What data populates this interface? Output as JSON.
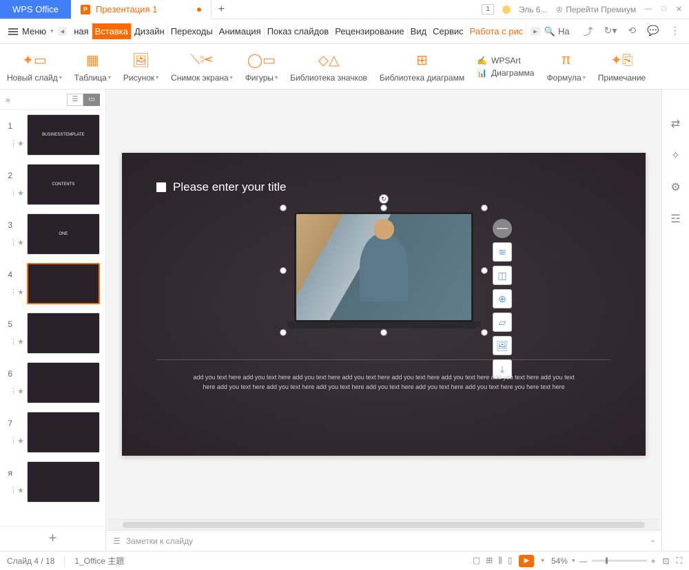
{
  "titlebar": {
    "app_name": "WPS Office",
    "tab_title": "Презентация 1",
    "tab_indicator": "1",
    "premium_label": "Перейти Премиум"
  },
  "menubar": {
    "menu_label": "Меню",
    "search_label": "На",
    "tabs": [
      "ная",
      "Вставка",
      "Дизайн",
      "Переходы",
      "Анимация",
      "Показ слайдов",
      "Рецензирование",
      "Вид",
      "Сервис",
      "Работа с рис"
    ]
  },
  "ribbon": {
    "new_slide": "Новый слайд",
    "table": "Таблица",
    "picture": "Рисунок",
    "screenshot": "Снимок экрана",
    "shapes": "Фигуры",
    "icons": "Библиотека значков",
    "charts_lib": "Библиотека диаграмм",
    "wpsart": "WPSArt",
    "chart": "Диаграмма",
    "formula": "Формула",
    "note": "Примечание"
  },
  "slide": {
    "title_placeholder": "Please enter your title",
    "body_text": "add you text here add you text here add you text here add you text here add you text here add you text here add you text here add you text here add you text here add you text here add you text here add you text here add you text here add you text here you here text here"
  },
  "thumbs": {
    "labels": [
      "BUSINESSTEMPLATE",
      "CONTENTS",
      "ONE",
      "",
      "",
      "",
      "",
      ""
    ],
    "selected_index": 3
  },
  "notes": {
    "placeholder": "Заметки к слайду",
    "collapse": "›"
  },
  "statusbar": {
    "slide_counter": "Слайд 4 / 18",
    "theme": "1_Office 主題",
    "zoom": "54%"
  }
}
